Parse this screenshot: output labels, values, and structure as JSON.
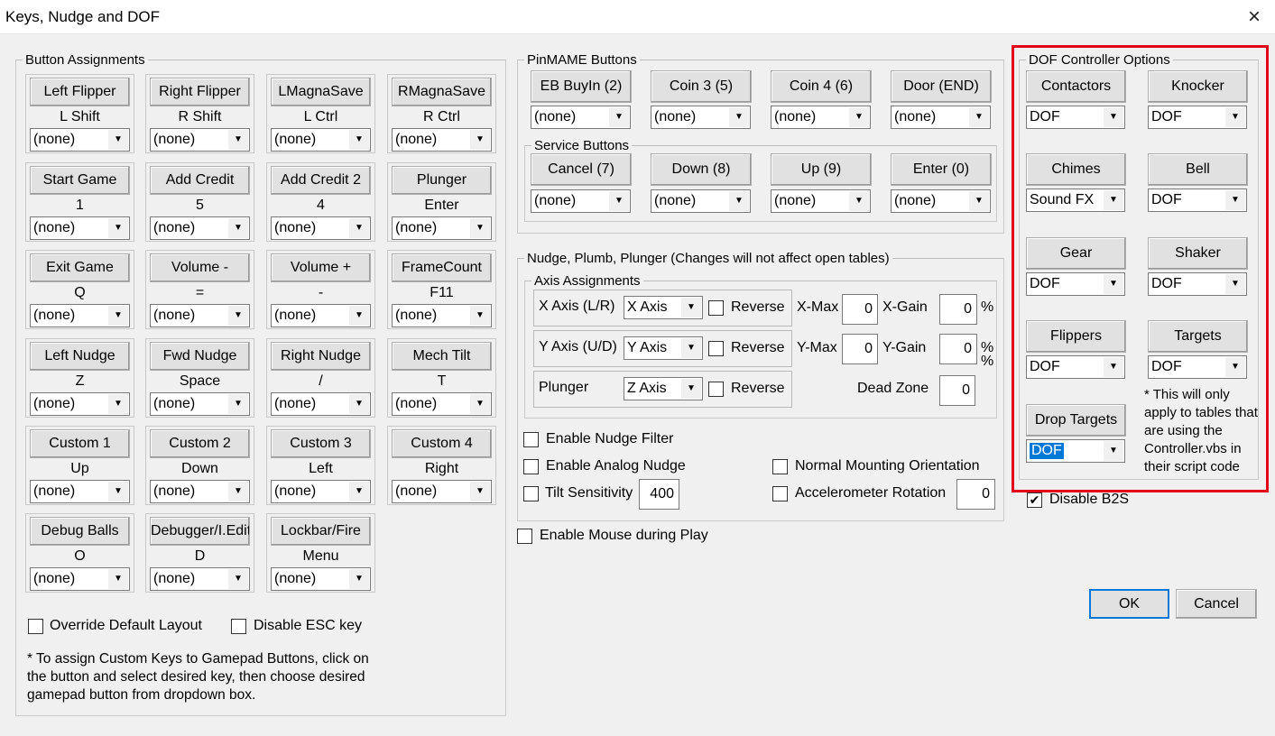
{
  "window": {
    "title": "Keys, Nudge and DOF",
    "close_icon": "×"
  },
  "button_assignments": {
    "legend": "Button Assignments",
    "cards": [
      {
        "button": "Left Flipper",
        "key": "L Shift",
        "gamepad": "(none)"
      },
      {
        "button": "Right Flipper",
        "key": "R Shift",
        "gamepad": "(none)"
      },
      {
        "button": "LMagnaSave",
        "key": "L Ctrl",
        "gamepad": "(none)"
      },
      {
        "button": "RMagnaSave",
        "key": "R Ctrl",
        "gamepad": "(none)"
      },
      {
        "button": "Start Game",
        "key": "1",
        "gamepad": "(none)"
      },
      {
        "button": "Add Credit",
        "key": "5",
        "gamepad": "(none)"
      },
      {
        "button": "Add Credit 2",
        "key": "4",
        "gamepad": "(none)"
      },
      {
        "button": "Plunger",
        "key": "Enter",
        "gamepad": "(none)"
      },
      {
        "button": "Exit Game",
        "key": "Q",
        "gamepad": "(none)"
      },
      {
        "button": "Volume -",
        "key": "=",
        "gamepad": "(none)"
      },
      {
        "button": "Volume +",
        "key": "-",
        "gamepad": "(none)"
      },
      {
        "button": "FrameCount",
        "key": "F11",
        "gamepad": "(none)"
      },
      {
        "button": "Left Nudge",
        "key": "Z",
        "gamepad": "(none)"
      },
      {
        "button": "Fwd Nudge",
        "key": "Space",
        "gamepad": "(none)"
      },
      {
        "button": "Right Nudge",
        "key": "/",
        "gamepad": "(none)"
      },
      {
        "button": "Mech Tilt",
        "key": "T",
        "gamepad": "(none)"
      },
      {
        "button": "Custom 1",
        "key": "Up",
        "gamepad": "(none)"
      },
      {
        "button": "Custom 2",
        "key": "Down",
        "gamepad": "(none)"
      },
      {
        "button": "Custom 3",
        "key": "Left",
        "gamepad": "(none)"
      },
      {
        "button": "Custom 4",
        "key": "Right",
        "gamepad": "(none)"
      },
      {
        "button": "Debug Balls",
        "key": "O",
        "gamepad": "(none)"
      },
      {
        "button": "Debugger/I.Edit",
        "key": "D",
        "gamepad": "(none)"
      },
      {
        "button": "Lockbar/Fire",
        "key": "Menu",
        "gamepad": "(none)"
      }
    ],
    "override_layout": {
      "label": "Override Default Layout",
      "checked": false
    },
    "disable_esc": {
      "label": "Disable ESC key",
      "checked": false
    },
    "note": "* To assign Custom Keys to Gamepad Buttons, click on the button and select desired key, then choose desired gamepad button from dropdown box."
  },
  "pinmame": {
    "legend": "PinMAME Buttons",
    "buttons": [
      {
        "label": "EB BuyIn (2)",
        "gamepad": "(none)"
      },
      {
        "label": "Coin 3 (5)",
        "gamepad": "(none)"
      },
      {
        "label": "Coin 4 (6)",
        "gamepad": "(none)"
      },
      {
        "label": "Door (END)",
        "gamepad": "(none)"
      }
    ],
    "service_legend": "Service Buttons",
    "service": [
      {
        "label": "Cancel (7)",
        "gamepad": "(none)"
      },
      {
        "label": "Down (8)",
        "gamepad": "(none)"
      },
      {
        "label": "Up (9)",
        "gamepad": "(none)"
      },
      {
        "label": "Enter (0)",
        "gamepad": "(none)"
      }
    ]
  },
  "nudge": {
    "legend": "Nudge, Plumb, Plunger (Changes will not affect open tables)",
    "axis_legend": "Axis Assignments",
    "axes": [
      {
        "label": "X Axis (L/R)",
        "value": "X Axis",
        "reverse": "Reverse"
      },
      {
        "label": "Y Axis (U/D)",
        "value": "Y Axis",
        "reverse": "Reverse"
      },
      {
        "label": "Plunger",
        "value": "Z Axis",
        "reverse": "Reverse"
      }
    ],
    "xmax_label": "X-Max",
    "xmax": "0",
    "xgain_label": "X-Gain",
    "xgain": "0",
    "ymax_label": "Y-Max",
    "ymax": "0",
    "ygain_label": "Y-Gain",
    "ygain": "0",
    "percent": "%",
    "deadzone_label": "Dead Zone",
    "deadzone": "0",
    "enable_filter": "Enable Nudge Filter",
    "enable_analog": "Enable Analog Nudge",
    "tilt_sensitivity": "Tilt Sensitivity",
    "tilt_value": "400",
    "normal_mounting": "Normal Mounting Orientation",
    "accel_rotation": "Accelerometer Rotation",
    "accel_value": "0",
    "enable_mouse": "Enable Mouse during Play"
  },
  "dof": {
    "legend": "DOF Controller Options",
    "items": [
      {
        "label": "Contactors",
        "value": "DOF"
      },
      {
        "label": "Knocker",
        "value": "DOF"
      },
      {
        "label": "Chimes",
        "value": "Sound FX"
      },
      {
        "label": "Bell",
        "value": "DOF"
      },
      {
        "label": "Gear",
        "value": "DOF"
      },
      {
        "label": "Shaker",
        "value": "DOF"
      },
      {
        "label": "Flippers",
        "value": "DOF"
      },
      {
        "label": "Targets",
        "value": "DOF"
      },
      {
        "label": "Drop Targets",
        "value": "DOF"
      }
    ],
    "note": "* This will only apply to tables that are using the Controller.vbs in their script code",
    "disable_b2s": {
      "label": "Disable B2S",
      "checked": true
    },
    "highlight_color": "#e3001b"
  },
  "footer": {
    "ok": "OK",
    "cancel": "Cancel"
  }
}
